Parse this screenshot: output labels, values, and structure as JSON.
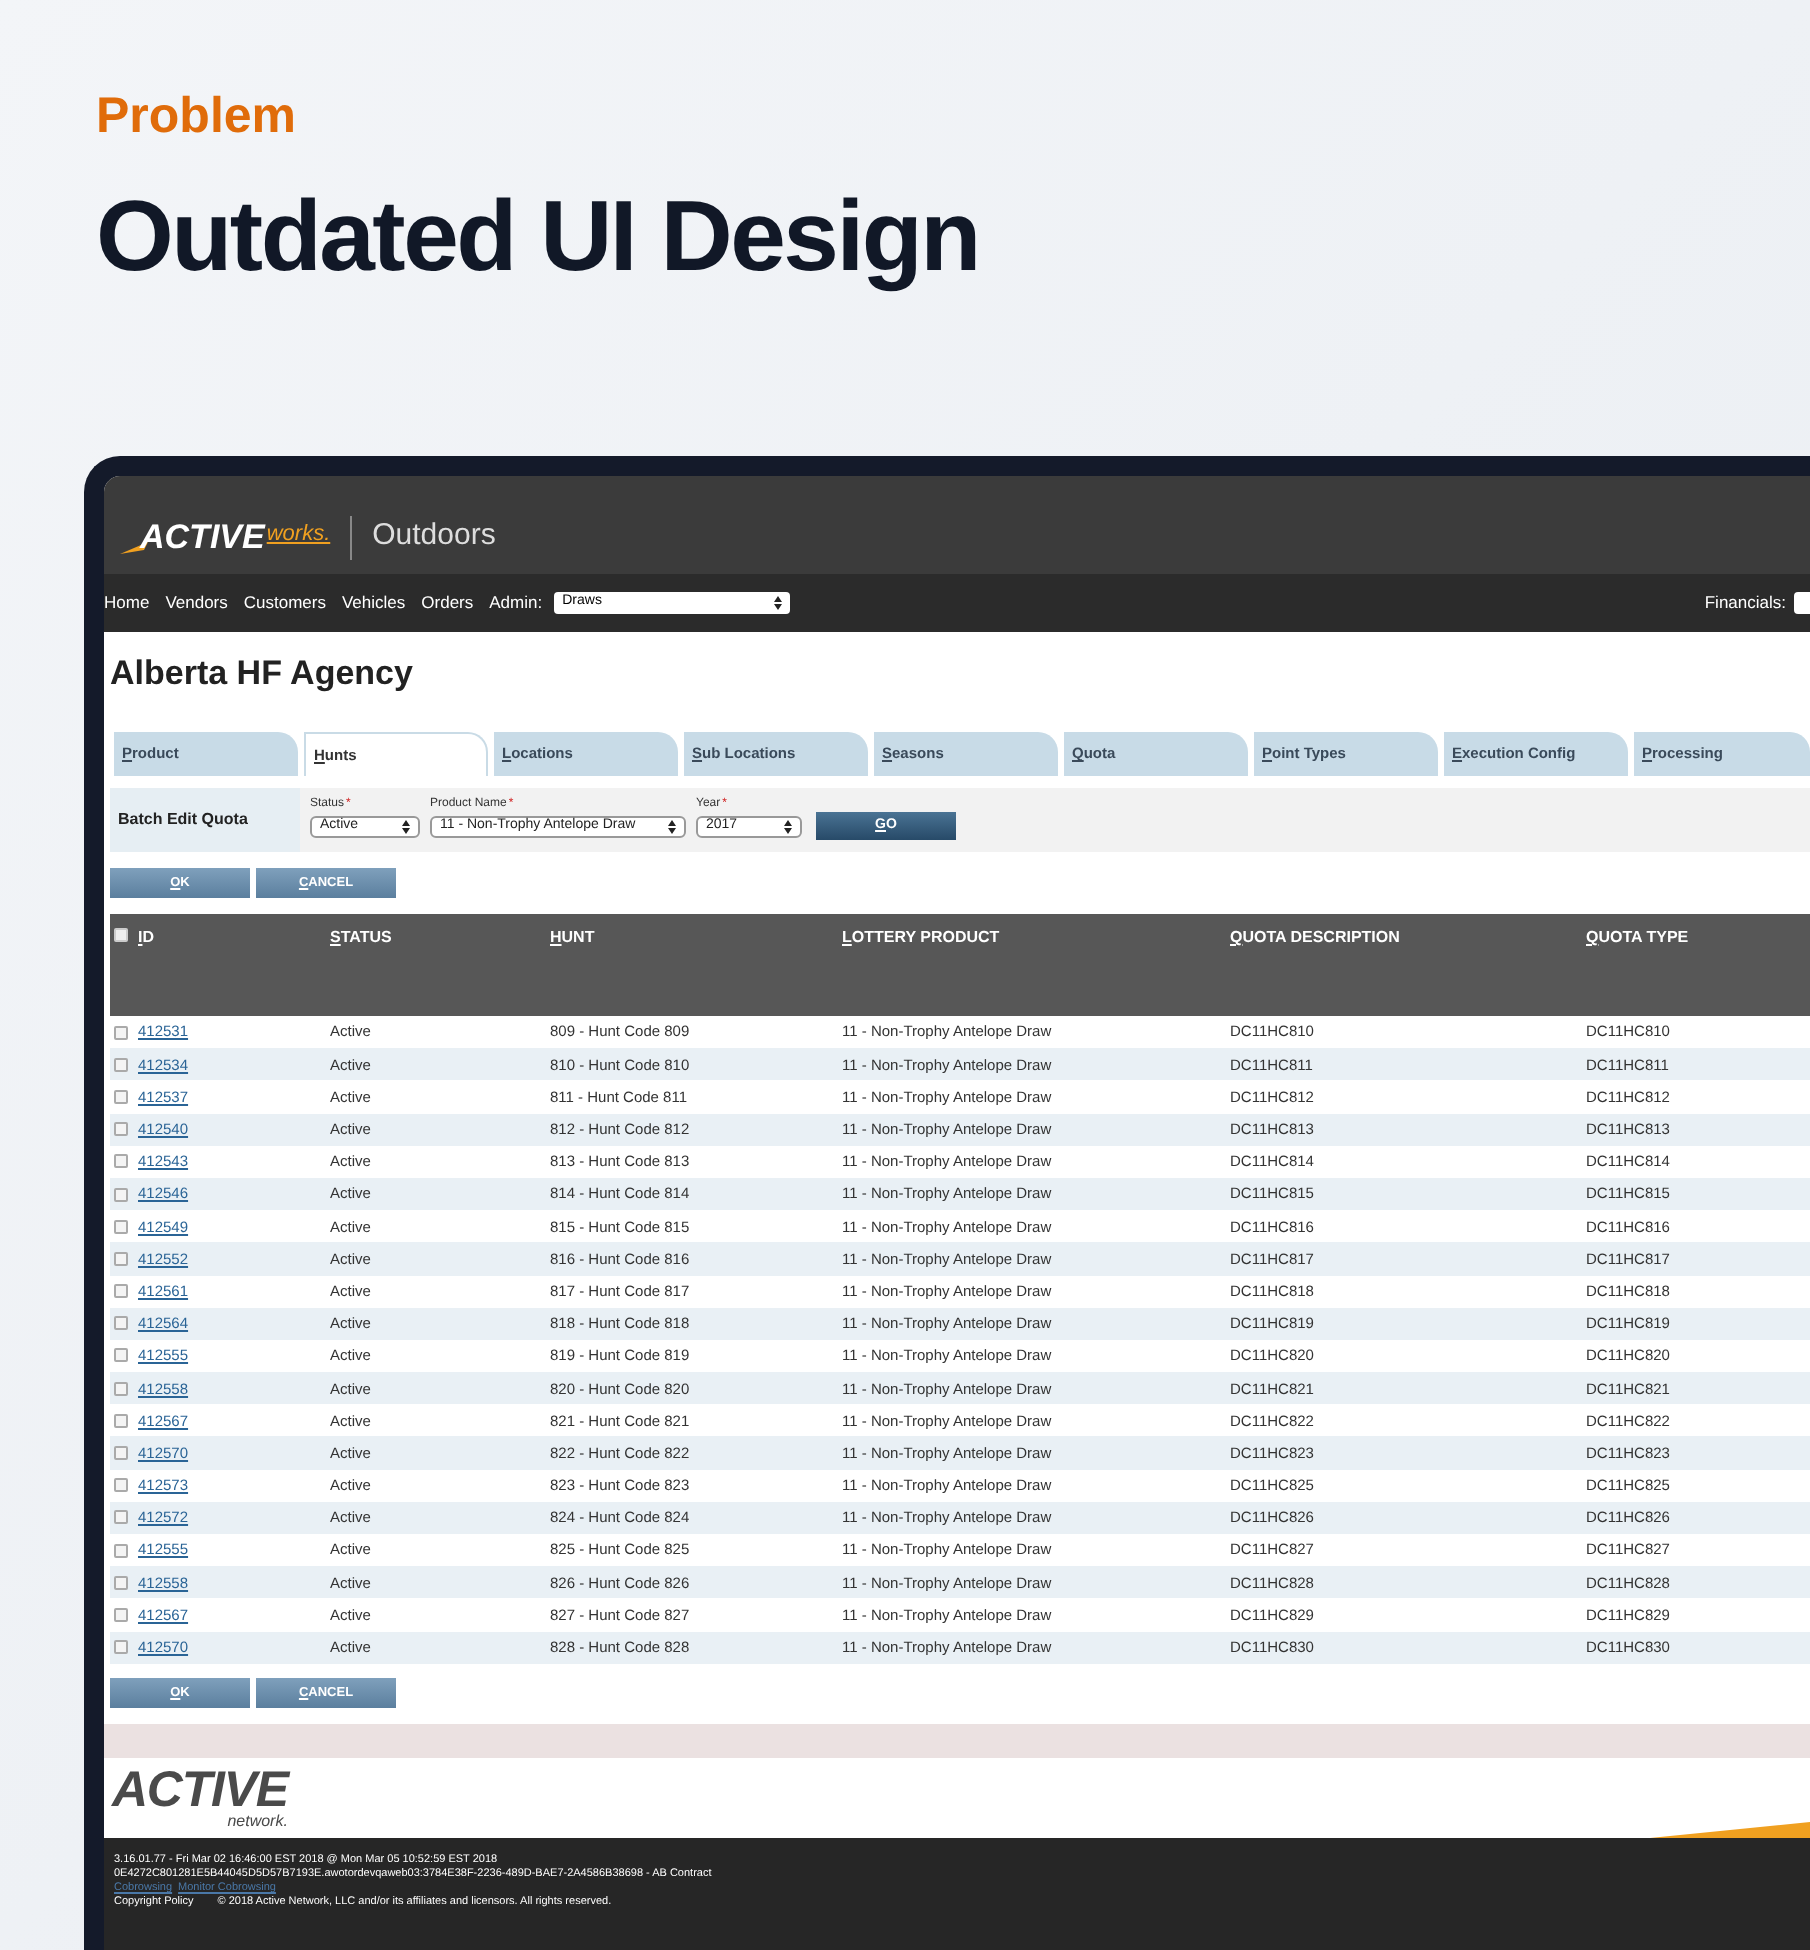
{
  "eyebrow": "Problem",
  "headline": "Outdated UI Design",
  "app": {
    "logo": {
      "brand": "ACTIVE",
      "suffix": "works.",
      "product": "Outdoors"
    },
    "nav": [
      {
        "label": "Home"
      },
      {
        "label": "Vendors"
      },
      {
        "label": "Customers"
      },
      {
        "label": "Vehicles"
      },
      {
        "label": "Orders"
      }
    ],
    "admin": {
      "label": "Admin:",
      "value": "Draws"
    },
    "financials": {
      "label": "Financials:"
    },
    "page_title": "Alberta HF Agency",
    "tabs": [
      {
        "label": "Product",
        "selected": false
      },
      {
        "label": "Hunts",
        "selected": true
      },
      {
        "label": "Locations",
        "selected": false
      },
      {
        "label": "Sub Locations",
        "selected": false
      },
      {
        "label": "Seasons",
        "selected": false
      },
      {
        "label": "Quota",
        "selected": false
      },
      {
        "label": "Point Types",
        "selected": false
      },
      {
        "label": "Execution Config",
        "selected": false
      },
      {
        "label": "Processing",
        "selected": false
      }
    ],
    "batch": {
      "title": "Batch Edit Quota",
      "fields": [
        {
          "label": "Status",
          "required": "*",
          "value": "Active"
        },
        {
          "label": "Product Name",
          "required": "*",
          "value": "11 - Non-Trophy Antelope Draw"
        },
        {
          "label": "Year",
          "required": "*",
          "value": "2017"
        }
      ],
      "go": "GO"
    },
    "actions": [
      "OK",
      "CANCEL"
    ],
    "actions_bottom": [
      "OK",
      "CANCEL"
    ],
    "table": {
      "select_all": {
        "checked": false
      },
      "columns": [
        "ID",
        "STATUS",
        "HUNT",
        "LOTTERY PRODUCT",
        "QUOTA DESCRIPTION",
        "QUOTA TYPE"
      ],
      "rows": [
        {
          "checked": false,
          "id": "412531",
          "status": "Active",
          "hunt": "809 - Hunt Code 809",
          "lottery_product": "11 - Non-Trophy Antelope Draw",
          "quota_description": "DC11HC810",
          "quota_type": "DC11HC810"
        },
        {
          "checked": false,
          "id": "412534",
          "status": "Active",
          "hunt": "810 - Hunt Code 810",
          "lottery_product": "11 - Non-Trophy Antelope Draw",
          "quota_description": "DC11HC811",
          "quota_type": "DC11HC811"
        },
        {
          "checked": false,
          "id": "412537",
          "status": "Active",
          "hunt": "811 - Hunt Code 811",
          "lottery_product": "11 - Non-Trophy Antelope Draw",
          "quota_description": "DC11HC812",
          "quota_type": "DC11HC812"
        },
        {
          "checked": false,
          "id": "412540",
          "status": "Active",
          "hunt": "812 - Hunt Code 812",
          "lottery_product": "11 - Non-Trophy Antelope Draw",
          "quota_description": "DC11HC813",
          "quota_type": "DC11HC813"
        },
        {
          "checked": false,
          "id": "412543",
          "status": "Active",
          "hunt": "813 - Hunt Code 813",
          "lottery_product": "11 - Non-Trophy Antelope Draw",
          "quota_description": "DC11HC814",
          "quota_type": "DC11HC814"
        },
        {
          "checked": false,
          "id": "412546",
          "status": "Active",
          "hunt": "814 - Hunt Code 814",
          "lottery_product": "11 - Non-Trophy Antelope Draw",
          "quota_description": "DC11HC815",
          "quota_type": "DC11HC815"
        },
        {
          "checked": false,
          "id": "412549",
          "status": "Active",
          "hunt": "815 - Hunt Code 815",
          "lottery_product": "11 - Non-Trophy Antelope Draw",
          "quota_description": "DC11HC816",
          "quota_type": "DC11HC816"
        },
        {
          "checked": false,
          "id": "412552",
          "status": "Active",
          "hunt": "816 - Hunt Code 816",
          "lottery_product": "11 - Non-Trophy Antelope Draw",
          "quota_description": "DC11HC817",
          "quota_type": "DC11HC817"
        },
        {
          "checked": false,
          "id": "412561",
          "status": "Active",
          "hunt": "817 - Hunt Code 817",
          "lottery_product": "11 - Non-Trophy Antelope Draw",
          "quota_description": "DC11HC818",
          "quota_type": "DC11HC818"
        },
        {
          "checked": false,
          "id": "412564",
          "status": "Active",
          "hunt": "818 - Hunt Code 818",
          "lottery_product": "11 - Non-Trophy Antelope Draw",
          "quota_description": "DC11HC819",
          "quota_type": "DC11HC819"
        },
        {
          "checked": false,
          "id": "412555",
          "status": "Active",
          "hunt": "819 - Hunt Code 819",
          "lottery_product": "11 - Non-Trophy Antelope Draw",
          "quota_description": "DC11HC820",
          "quota_type": "DC11HC820"
        },
        {
          "checked": false,
          "id": "412558",
          "status": "Active",
          "hunt": "820 - Hunt Code 820",
          "lottery_product": "11 - Non-Trophy Antelope Draw",
          "quota_description": "DC11HC821",
          "quota_type": "DC11HC821"
        },
        {
          "checked": false,
          "id": "412567",
          "status": "Active",
          "hunt": "821 - Hunt Code 821",
          "lottery_product": "11 - Non-Trophy Antelope Draw",
          "quota_description": "DC11HC822",
          "quota_type": "DC11HC822"
        },
        {
          "checked": false,
          "id": "412570",
          "status": "Active",
          "hunt": "822 - Hunt Code 822",
          "lottery_product": "11 - Non-Trophy Antelope Draw",
          "quota_description": "DC11HC823",
          "quota_type": "DC11HC823"
        },
        {
          "checked": false,
          "id": "412573",
          "status": "Active",
          "hunt": "823 - Hunt Code 823",
          "lottery_product": "11 - Non-Trophy Antelope Draw",
          "quota_description": "DC11HC825",
          "quota_type": "DC11HC825"
        },
        {
          "checked": false,
          "id": "412572",
          "status": "Active",
          "hunt": "824 - Hunt Code 824",
          "lottery_product": "11 - Non-Trophy Antelope Draw",
          "quota_description": "DC11HC826",
          "quota_type": "DC11HC826"
        },
        {
          "checked": false,
          "id": "412555",
          "status": "Active",
          "hunt": "825 - Hunt Code 825",
          "lottery_product": "11 - Non-Trophy Antelope Draw",
          "quota_description": "DC11HC827",
          "quota_type": "DC11HC827"
        },
        {
          "checked": false,
          "id": "412558",
          "status": "Active",
          "hunt": "826 - Hunt Code 826",
          "lottery_product": "11 - Non-Trophy Antelope Draw",
          "quota_description": "DC11HC828",
          "quota_type": "DC11HC828"
        },
        {
          "checked": false,
          "id": "412567",
          "status": "Active",
          "hunt": "827 - Hunt Code 827",
          "lottery_product": "11 - Non-Trophy Antelope Draw",
          "quota_description": "DC11HC829",
          "quota_type": "DC11HC829"
        },
        {
          "checked": false,
          "id": "412570",
          "status": "Active",
          "hunt": "828 - Hunt Code 828",
          "lottery_product": "11 - Non-Trophy Antelope Draw",
          "quota_description": "DC11HC830",
          "quota_type": "DC11HC830"
        }
      ]
    },
    "footer_logo": {
      "brand": "ACTIVE",
      "suffix": "network."
    },
    "footer": {
      "lines": [
        "3.16.01.77 - Fri Mar 02 16:46:00 EST 2018 @ Mon Mar 05 10:52:59 EST 2018",
        "0E4272C801281E5B44045D5D57B7193E.awotordevqaweb03:3784E38F-2236-489D-BAE7-2A4586B38698 - AB Contract"
      ],
      "links": [
        "Cobrowsing",
        "Monitor Cobrowsing"
      ],
      "copyright": {
        "link": "Copyright Policy",
        "text": "© 2018 Active Network, LLC and/or its affiliates and licensors. All rights reserved."
      }
    }
  }
}
